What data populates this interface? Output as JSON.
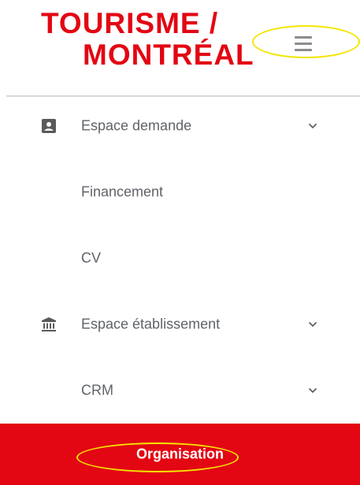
{
  "app": {
    "logo": {
      "line1": "TOURISME /",
      "line2": "MONTRÉAL",
      "color": "#e30613"
    }
  },
  "header": {
    "menu_icon": "hamburger-icon"
  },
  "menu": {
    "items": [
      {
        "label": "Espace demande",
        "icon": "contact-card-icon",
        "has_chevron": true
      },
      {
        "label": "Financement",
        "icon": null,
        "has_chevron": false
      },
      {
        "label": "CV",
        "icon": null,
        "has_chevron": false
      },
      {
        "label": "Espace établissement",
        "icon": "institution-icon",
        "has_chevron": true
      },
      {
        "label": "CRM",
        "icon": null,
        "has_chevron": true
      },
      {
        "label": "Organisation",
        "icon": null,
        "has_chevron": false,
        "active": true
      }
    ]
  },
  "colors": {
    "accent": "#e30613",
    "text": "#5f6368",
    "highlight": "#f2e600",
    "divider": "#d9d9d9"
  }
}
